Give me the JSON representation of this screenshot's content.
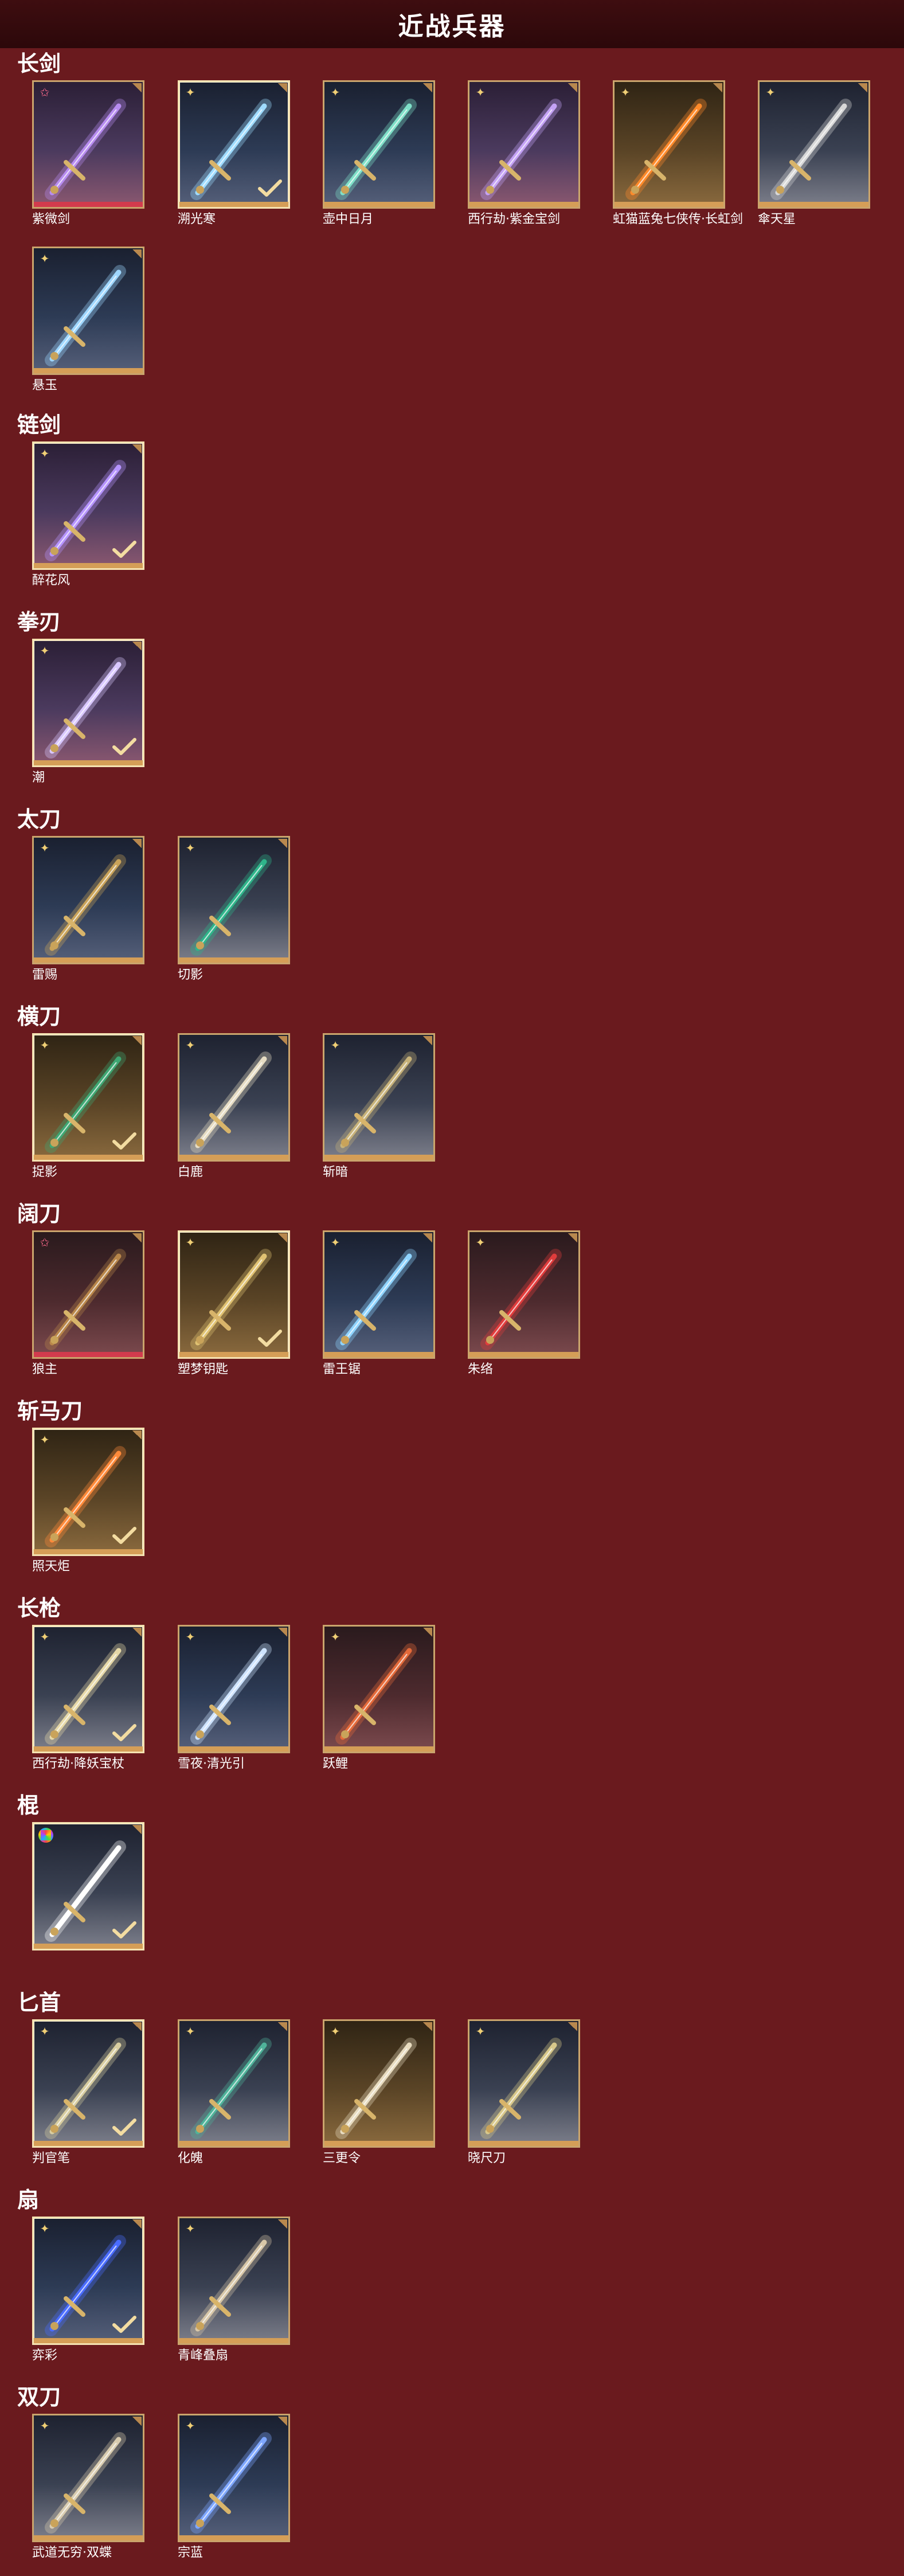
{
  "page_title": "近战兵器",
  "categories": [
    {
      "title": "长剑",
      "items": [
        {
          "name": "紫微剑",
          "badge": "pink-star",
          "rarity": "red",
          "selected": false,
          "tone": "pink",
          "weapon_color": "#b78cf0"
        },
        {
          "name": "溯光寒",
          "badge": "gold-star",
          "rarity": "gold",
          "selected": true,
          "tone": "blue",
          "weapon_color": "#9fdcff"
        },
        {
          "name": "壶中日月",
          "badge": "gold-star",
          "rarity": "gold",
          "selected": false,
          "tone": "blue",
          "weapon_color": "#7fe0c8"
        },
        {
          "name": "西行劫·紫金宝剑",
          "badge": "gold-star",
          "rarity": "gold",
          "selected": false,
          "tone": "pink",
          "weapon_color": "#c4a2f5"
        },
        {
          "name": "虹猫蓝兔七侠传·长虹剑",
          "badge": "gold-star",
          "rarity": "gold",
          "selected": false,
          "tone": "gold",
          "weapon_color": "#ff8a2a"
        },
        {
          "name": "傘天星",
          "badge": "gold-star",
          "rarity": "gold",
          "selected": false,
          "tone": "white",
          "weapon_color": "#d8d8d8"
        },
        {
          "name": "悬玉",
          "badge": "gold-star",
          "rarity": "gold",
          "selected": false,
          "tone": "blue",
          "weapon_color": "#9fd7ff"
        }
      ]
    },
    {
      "title": "链剑",
      "items": [
        {
          "name": "醉花风",
          "badge": "gold-star",
          "rarity": "gold",
          "selected": true,
          "tone": "pink",
          "weapon_color": "#b694ff"
        }
      ]
    },
    {
      "title": "拳刃",
      "items": [
        {
          "name": "潮",
          "badge": "gold-star",
          "rarity": "gold",
          "selected": true,
          "tone": "pink",
          "weapon_color": "#d9c8ff"
        }
      ]
    },
    {
      "title": "太刀",
      "items": [
        {
          "name": "雷赐",
          "badge": "gold-star",
          "rarity": "gold",
          "selected": false,
          "tone": "blue",
          "weapon_color": "#c9a35a"
        },
        {
          "name": "切影",
          "badge": "gold-star",
          "rarity": "gold",
          "selected": false,
          "tone": "white",
          "weapon_color": "#2fb48a"
        }
      ]
    },
    {
      "title": "横刀",
      "items": [
        {
          "name": "捉影",
          "badge": "gold-star",
          "rarity": "gold",
          "selected": true,
          "tone": "gold",
          "weapon_color": "#3fa773"
        },
        {
          "name": "白鹿",
          "badge": "gold-star",
          "rarity": "gold",
          "selected": false,
          "tone": "white",
          "weapon_color": "#e6dcc3"
        },
        {
          "name": "斩暗",
          "badge": "gold-star",
          "rarity": "gold",
          "selected": false,
          "tone": "white",
          "weapon_color": "#c7b27a"
        }
      ]
    },
    {
      "title": "阔刀",
      "items": [
        {
          "name": "狼主",
          "badge": "pink-star",
          "rarity": "red",
          "selected": false,
          "tone": "red",
          "weapon_color": "#b8864a"
        },
        {
          "name": "塑梦钥匙",
          "badge": "gold-star",
          "rarity": "gold",
          "selected": true,
          "tone": "gold",
          "weapon_color": "#e0c272"
        },
        {
          "name": "雷王锯",
          "badge": "gold-star",
          "rarity": "gold",
          "selected": false,
          "tone": "blue",
          "weapon_color": "#8fd4ff"
        },
        {
          "name": "朱络",
          "badge": "gold-star",
          "rarity": "gold",
          "selected": false,
          "tone": "red",
          "weapon_color": "#e03c3c"
        }
      ]
    },
    {
      "title": "斩马刀",
      "items": [
        {
          "name": "照天炬",
          "badge": "gold-star",
          "rarity": "gold",
          "selected": true,
          "tone": "gold",
          "weapon_color": "#ff8a3a"
        }
      ]
    },
    {
      "title": "长枪",
      "items": [
        {
          "name": "西行劫·降妖宝杖",
          "badge": "gold-star",
          "rarity": "gold",
          "selected": true,
          "tone": "white",
          "weapon_color": "#e7d9a8"
        },
        {
          "name": "雪夜·清光引",
          "badge": "gold-star",
          "rarity": "gold",
          "selected": false,
          "tone": "blue",
          "weapon_color": "#cfe4ff"
        },
        {
          "name": "跃鲤",
          "badge": "gold-star",
          "rarity": "gold",
          "selected": false,
          "tone": "red",
          "weapon_color": "#e46a3a"
        }
      ]
    },
    {
      "title": "棍",
      "items": [
        {
          "name": "",
          "badge": "rainbow",
          "rarity": "gold",
          "selected": true,
          "tone": "white",
          "weapon_color": "#ffffff"
        }
      ]
    },
    {
      "title": "匕首",
      "items": [
        {
          "name": "判官笔",
          "badge": "gold-star",
          "rarity": "gold",
          "selected": true,
          "tone": "white",
          "weapon_color": "#d8cda0"
        },
        {
          "name": "化魄",
          "badge": "gold-star",
          "rarity": "gold",
          "selected": false,
          "tone": "white",
          "weapon_color": "#4fb39a"
        },
        {
          "name": "三更令",
          "badge": "gold-star",
          "rarity": "gold",
          "selected": false,
          "tone": "gold",
          "weapon_color": "#e8dcc0"
        },
        {
          "name": "晓尺刀",
          "badge": "gold-star",
          "rarity": "gold",
          "selected": false,
          "tone": "white",
          "weapon_color": "#d8c88a"
        }
      ]
    },
    {
      "title": "扇",
      "items": [
        {
          "name": "弈彩",
          "badge": "gold-star",
          "rarity": "gold",
          "selected": true,
          "tone": "blue",
          "weapon_color": "#4a6cff"
        },
        {
          "name": "青峰叠扇",
          "badge": "gold-star",
          "rarity": "gold",
          "selected": false,
          "tone": "white",
          "weapon_color": "#d8c7a8"
        }
      ]
    },
    {
      "title": "双刀",
      "items": [
        {
          "name": "武道无穷·双蝶",
          "badge": "gold-star",
          "rarity": "gold",
          "selected": false,
          "tone": "white",
          "weapon_color": "#d9ccb0"
        },
        {
          "name": "宗蓝",
          "badge": "gold-star",
          "rarity": "gold",
          "selected": false,
          "tone": "blue",
          "weapon_color": "#7fa7ff"
        }
      ]
    }
  ]
}
